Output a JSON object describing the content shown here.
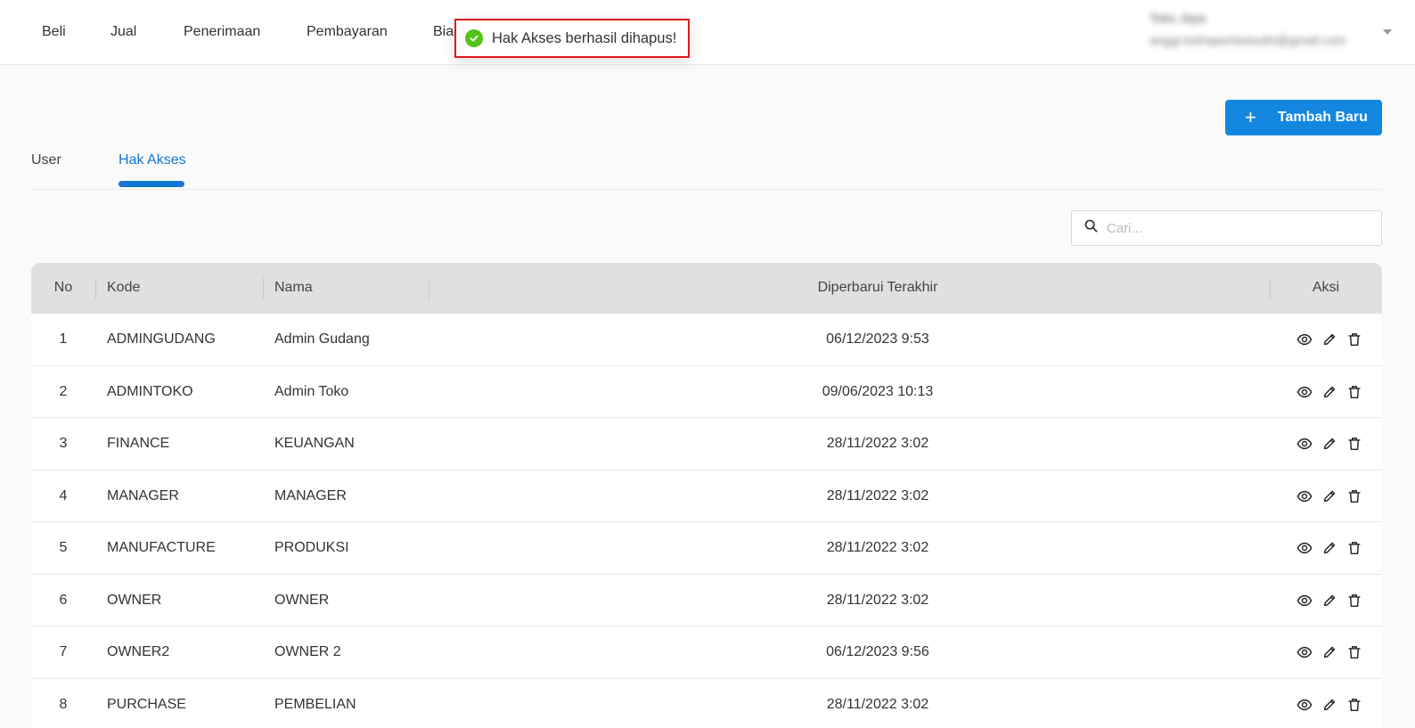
{
  "nav": {
    "items": [
      "Beli",
      "Jual",
      "Penerimaan",
      "Pembayaran",
      "Bia"
    ],
    "user_name": "Toko Jaya",
    "user_email": "anggi.indriapertiwisuthi@gmail.com"
  },
  "toast": {
    "message": "Hak Akses berhasil dihapus!",
    "color": "#52c41a"
  },
  "add_button": {
    "label": "Tambah Baru",
    "color": "#1387e0"
  },
  "tabs": [
    {
      "label": "User",
      "active": false
    },
    {
      "label": "Hak Akses",
      "active": true
    }
  ],
  "search": {
    "placeholder": "Cari..."
  },
  "table": {
    "headers": {
      "no": "No",
      "kode": "Kode",
      "nama": "Nama",
      "updated": "Diperbarui Terakhir",
      "aksi": "Aksi"
    },
    "rows": [
      {
        "no": "1",
        "kode": "ADMINGUDANG",
        "nama": "Admin Gudang",
        "updated": "06/12/2023 9:53"
      },
      {
        "no": "2",
        "kode": "ADMINTOKO",
        "nama": "Admin Toko",
        "updated": "09/06/2023 10:13"
      },
      {
        "no": "3",
        "kode": "FINANCE",
        "nama": "KEUANGAN",
        "updated": "28/11/2022 3:02"
      },
      {
        "no": "4",
        "kode": "MANAGER",
        "nama": "MANAGER",
        "updated": "28/11/2022 3:02"
      },
      {
        "no": "5",
        "kode": "MANUFACTURE",
        "nama": "PRODUKSI",
        "updated": "28/11/2022 3:02"
      },
      {
        "no": "6",
        "kode": "OWNER",
        "nama": "OWNER",
        "updated": "28/11/2022 3:02"
      },
      {
        "no": "7",
        "kode": "OWNER2",
        "nama": "OWNER 2",
        "updated": "06/12/2023 9:56"
      },
      {
        "no": "8",
        "kode": "PURCHASE",
        "nama": "PEMBELIAN",
        "updated": "28/11/2022 3:02"
      }
    ],
    "row_actions": [
      "eye-icon",
      "pencil-icon",
      "trash-icon"
    ]
  }
}
